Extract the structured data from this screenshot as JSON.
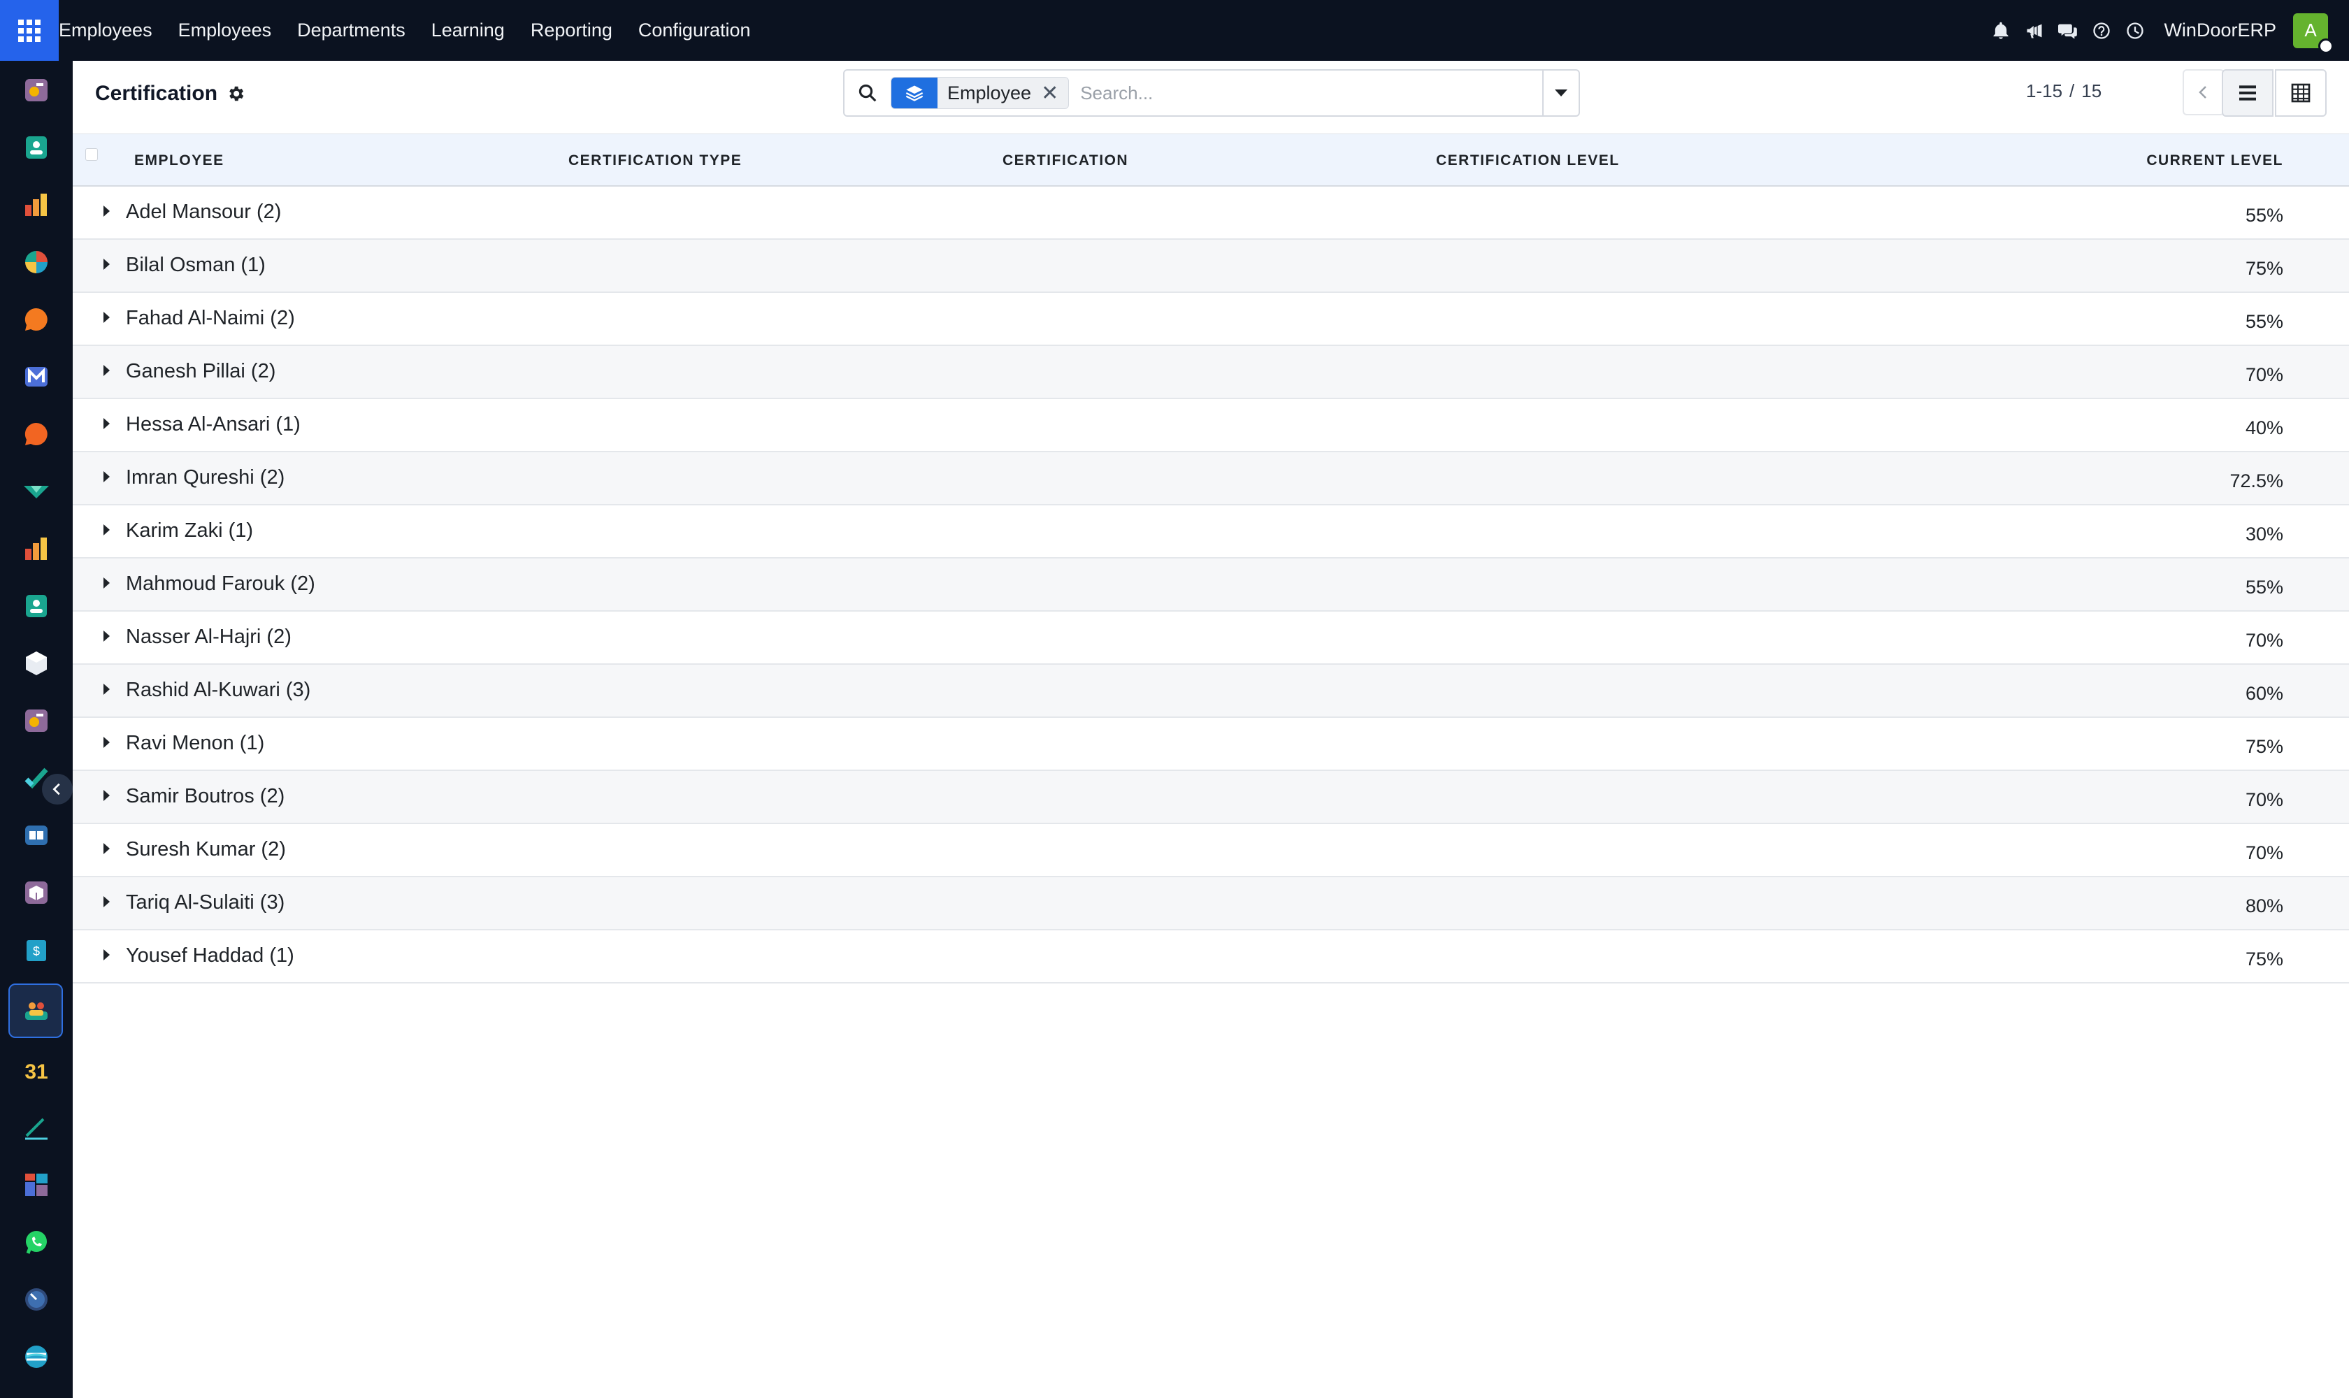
{
  "nav": {
    "brand": "Employees",
    "items": [
      "Employees",
      "Departments",
      "Learning",
      "Reporting",
      "Configuration"
    ],
    "company": "WinDoorERP",
    "avatar_letter": "A"
  },
  "control": {
    "title": "Certification",
    "search": {
      "facet_label": "Employee",
      "facet_remove": "✕",
      "placeholder": "Search..."
    },
    "pager": {
      "range": "1-15",
      "separator": "/",
      "total": "15"
    }
  },
  "table": {
    "columns": [
      "EMPLOYEE",
      "CERTIFICATION TYPE",
      "CERTIFICATION",
      "CERTIFICATION LEVEL",
      "CURRENT LEVEL"
    ],
    "rows": [
      {
        "name": "Adel Mansour (2)",
        "level": "55%"
      },
      {
        "name": "Bilal Osman (1)",
        "level": "75%"
      },
      {
        "name": "Fahad Al-Naimi (2)",
        "level": "55%"
      },
      {
        "name": "Ganesh Pillai (2)",
        "level": "70%"
      },
      {
        "name": "Hessa Al-Ansari (1)",
        "level": "40%"
      },
      {
        "name": "Imran Qureshi (2)",
        "level": "72.5%"
      },
      {
        "name": "Karim Zaki (1)",
        "level": "30%"
      },
      {
        "name": "Mahmoud Farouk (2)",
        "level": "55%"
      },
      {
        "name": "Nasser Al-Hajri (2)",
        "level": "70%"
      },
      {
        "name": "Rashid Al-Kuwari (3)",
        "level": "60%"
      },
      {
        "name": "Ravi Menon (1)",
        "level": "75%"
      },
      {
        "name": "Samir Boutros (2)",
        "level": "70%"
      },
      {
        "name": "Suresh Kumar (2)",
        "level": "70%"
      },
      {
        "name": "Tariq Al-Sulaiti (3)",
        "level": "80%"
      },
      {
        "name": "Yousef Haddad (1)",
        "level": "75%"
      }
    ]
  },
  "sidebar": {
    "apps": [
      "dashboard-app-icon",
      "contacts-app-icon",
      "sales-app-icon",
      "crm-app-icon",
      "discuss-app-icon",
      "email-marketing-app-icon",
      "livechat-app-icon",
      "inventory-app-icon",
      "reporting-app-icon",
      "employees-app-icon",
      "product-app-icon",
      "documents-app-icon",
      "project-app-icon",
      "knowledge-app-icon",
      "barcode-app-icon",
      "expenses-app-icon",
      "certification-app-icon",
      "calendar-app-icon",
      "sign-app-icon",
      "dashboards-app-icon",
      "whatsapp-app-icon",
      "timesheet-app-icon",
      "website-app-icon"
    ],
    "calendar_day": "31"
  },
  "colors": {
    "navbar": "#0b1220",
    "accent": "#2563eb",
    "header_row": "#eef4fd",
    "avatar": "#65b32e"
  }
}
